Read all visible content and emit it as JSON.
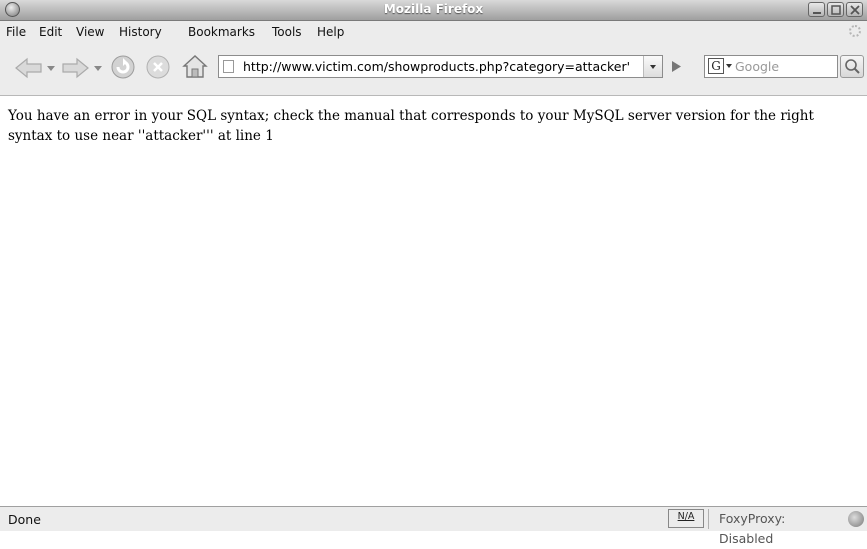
{
  "window": {
    "title": "Mozilla Firefox"
  },
  "menu": {
    "items": [
      "File",
      "Edit",
      "View",
      "History",
      "Bookmarks",
      "Tools",
      "Help"
    ]
  },
  "navbar": {
    "url": "http://www.victim.com/showproducts.php?category=attacker'",
    "search_placeholder": "Google",
    "search_engine_icon": "G"
  },
  "content": {
    "error_text": "You have an error in your SQL syntax; check the manual that corresponds to your MySQL server version for the right syntax to use near ''attacker''' at line 1"
  },
  "statusbar": {
    "status": "Done",
    "na_label": "N/A",
    "foxyproxy": "FoxyProxy: Disabled"
  },
  "icons": {
    "app": "firefox-icon",
    "back": "back-arrow-icon",
    "forward": "forward-arrow-icon",
    "reload": "reload-icon",
    "stop": "stop-icon",
    "home": "home-icon",
    "go": "go-arrow-icon",
    "search": "magnifier-icon",
    "foxyproxy": "foxyproxy-icon"
  }
}
